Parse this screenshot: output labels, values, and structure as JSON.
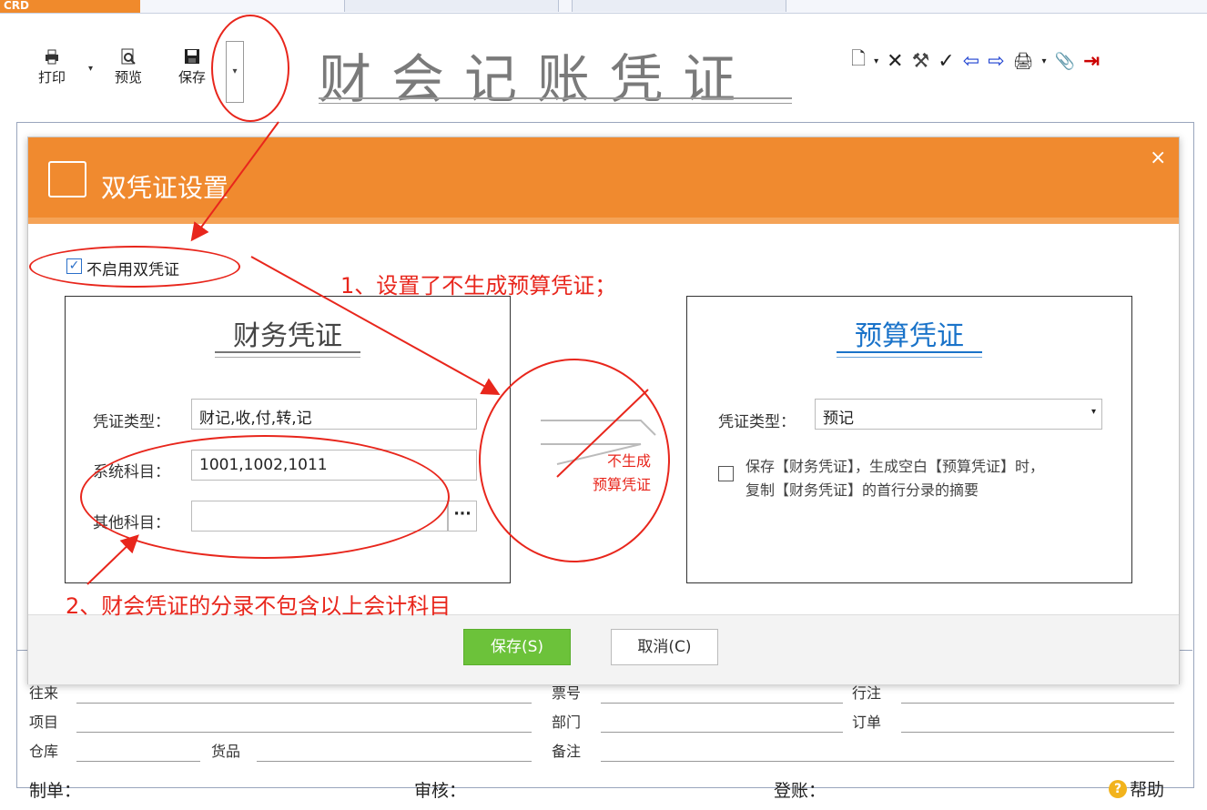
{
  "top_strip": {
    "logo_text": "CRD"
  },
  "toolbar": {
    "print_label": "打印",
    "preview_label": "预览",
    "save_label": "保存",
    "dropdown_glyph": "▾"
  },
  "app_title": "财会记账凭证",
  "right_tools": {
    "icons": [
      "new-doc-icon",
      "caret-icon",
      "delete-icon",
      "tools-icon",
      "check-icon",
      "arrow-left-icon",
      "arrow-right-icon",
      "print-setup-icon",
      "caret-icon",
      "attach-icon",
      "exit-icon"
    ],
    "glyphs": {
      "new": "🗋",
      "caret": "▾",
      "delete": "✕",
      "tools": "⚒",
      "check": "✓",
      "left": "⇦",
      "right": "⇨",
      "printset": "🖨",
      "caret2": "▾",
      "attach": "📎",
      "exit": "⇥"
    }
  },
  "dialog": {
    "title": "双凭证设置",
    "close": "×",
    "disable_dual_label": "不启用双凭证",
    "disable_dual_checked": true,
    "finance": {
      "title": "财务凭证",
      "voucher_type_label": "凭证类型：",
      "voucher_type_value": "财记,收,付,转,记",
      "system_subject_label": "系统科目：",
      "system_subject_value": "1001,1002,1011",
      "other_subject_label": "其他科目：",
      "other_subject_value": "",
      "browse_glyph": "···"
    },
    "middle": {
      "text_line1": "不生成",
      "text_line2": "预算凭证"
    },
    "budget": {
      "title": "预算凭证",
      "voucher_type_label": "凭证类型：",
      "voucher_type_value": "预记",
      "copy_summary_label_line1": "保存【财务凭证】，生成空白【预算凭证】时，",
      "copy_summary_label_line2": "复制【财务凭证】的首行分录的摘要",
      "copy_summary_checked": false
    },
    "save_button": "保存(S)",
    "cancel_button": "取消(C)"
  },
  "annotations": {
    "note1": "1、设置了不生成预算凭证；",
    "note2": "2、财会凭证的分录不包含以上会计科目"
  },
  "background_form": {
    "row1_left": "往来",
    "row1_mid": "票号",
    "row1_right": "行注",
    "row2_left": "项目",
    "row2_mid": "部门",
    "row2_right": "订单",
    "row3_left": "仓库",
    "row3_left2": "货品",
    "row3_mid": "备注"
  },
  "bottom_bar": {
    "maker": "制单：",
    "auditor": "审核：",
    "poster": "登账：",
    "help": "帮助"
  },
  "colors": {
    "accent": "#f08a2f",
    "save_green": "#6cc23a",
    "annotation_red": "#e8261c",
    "link_blue": "#1a73c9"
  }
}
